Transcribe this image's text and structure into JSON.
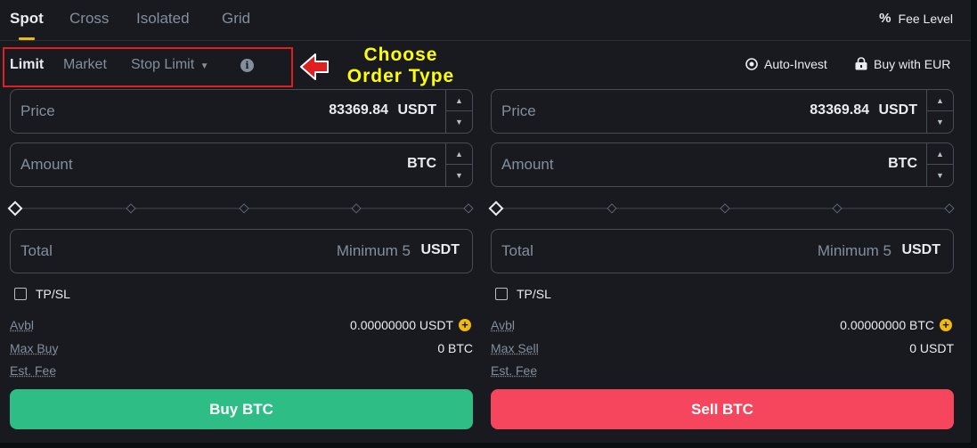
{
  "tabs": [
    "Spot",
    "Cross",
    "Isolated",
    "Grid"
  ],
  "fee_level": "Fee Level",
  "order_types": [
    "Limit",
    "Market",
    "Stop Limit"
  ],
  "annotation": "Choose Order Type",
  "links": {
    "auto_invest": "Auto-Invest",
    "buy_with": "Buy with EUR"
  },
  "buy": {
    "price_label": "Price",
    "price_value": "83369.84",
    "price_unit": "USDT",
    "amount_label": "Amount",
    "amount_unit": "BTC",
    "total_label": "Total",
    "total_placeholder": "Minimum 5",
    "total_unit": "USDT",
    "tpsl": "TP/SL",
    "avbl_label": "Avbl",
    "avbl_value": "0.00000000 USDT",
    "max_label": "Max Buy",
    "max_value": "0 BTC",
    "fee_label": "Est. Fee",
    "button": "Buy BTC"
  },
  "sell": {
    "price_label": "Price",
    "price_value": "83369.84",
    "price_unit": "USDT",
    "amount_label": "Amount",
    "amount_unit": "BTC",
    "total_label": "Total",
    "total_placeholder": "Minimum 5",
    "total_unit": "USDT",
    "tpsl": "TP/SL",
    "avbl_label": "Avbl",
    "avbl_value": "0.00000000 BTC",
    "max_label": "Max Sell",
    "max_value": "0 USDT",
    "fee_label": "Est. Fee",
    "button": "Sell BTC"
  },
  "colors": {
    "accent": "#f0b90b",
    "buy": "#2ebd85",
    "sell": "#f6465d",
    "annotation": "#ffff00",
    "highlight": "#e02020"
  }
}
